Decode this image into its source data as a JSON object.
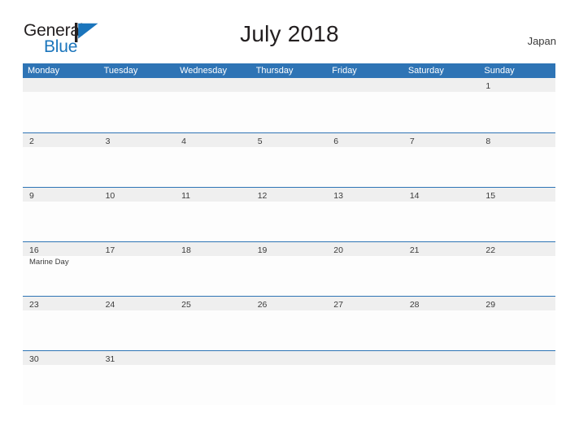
{
  "brand": {
    "name_part1": "General",
    "name_part2": "Blue",
    "flag_icon": "blue-triangle-flag-icon",
    "color_dark": "#231f20",
    "color_blue": "#1b75bc"
  },
  "header": {
    "title": "July 2018",
    "country": "Japan"
  },
  "theme": {
    "header_blue": "#2e74b5",
    "date_band_gray": "#efefef",
    "row_divider_blue": "#2e74b5",
    "text_dark": "#3b3b3b",
    "page_background": "#ffffff"
  },
  "calendar": {
    "month": "July",
    "year": "2018",
    "weekday_headers": [
      "Monday",
      "Tuesday",
      "Wednesday",
      "Thursday",
      "Friday",
      "Saturday",
      "Sunday"
    ],
    "weeks": [
      {
        "days": [
          {
            "number": "",
            "event": ""
          },
          {
            "number": "",
            "event": ""
          },
          {
            "number": "",
            "event": ""
          },
          {
            "number": "",
            "event": ""
          },
          {
            "number": "",
            "event": ""
          },
          {
            "number": "",
            "event": ""
          },
          {
            "number": "1",
            "event": ""
          }
        ]
      },
      {
        "days": [
          {
            "number": "2",
            "event": ""
          },
          {
            "number": "3",
            "event": ""
          },
          {
            "number": "4",
            "event": ""
          },
          {
            "number": "5",
            "event": ""
          },
          {
            "number": "6",
            "event": ""
          },
          {
            "number": "7",
            "event": ""
          },
          {
            "number": "8",
            "event": ""
          }
        ]
      },
      {
        "days": [
          {
            "number": "9",
            "event": ""
          },
          {
            "number": "10",
            "event": ""
          },
          {
            "number": "11",
            "event": ""
          },
          {
            "number": "12",
            "event": ""
          },
          {
            "number": "13",
            "event": ""
          },
          {
            "number": "14",
            "event": ""
          },
          {
            "number": "15",
            "event": ""
          }
        ]
      },
      {
        "days": [
          {
            "number": "16",
            "event": "Marine Day"
          },
          {
            "number": "17",
            "event": ""
          },
          {
            "number": "18",
            "event": ""
          },
          {
            "number": "19",
            "event": ""
          },
          {
            "number": "20",
            "event": ""
          },
          {
            "number": "21",
            "event": ""
          },
          {
            "number": "22",
            "event": ""
          }
        ]
      },
      {
        "days": [
          {
            "number": "23",
            "event": ""
          },
          {
            "number": "24",
            "event": ""
          },
          {
            "number": "25",
            "event": ""
          },
          {
            "number": "26",
            "event": ""
          },
          {
            "number": "27",
            "event": ""
          },
          {
            "number": "28",
            "event": ""
          },
          {
            "number": "29",
            "event": ""
          }
        ]
      },
      {
        "days": [
          {
            "number": "30",
            "event": ""
          },
          {
            "number": "31",
            "event": ""
          },
          {
            "number": "",
            "event": ""
          },
          {
            "number": "",
            "event": ""
          },
          {
            "number": "",
            "event": ""
          },
          {
            "number": "",
            "event": ""
          },
          {
            "number": "",
            "event": ""
          }
        ]
      }
    ]
  }
}
